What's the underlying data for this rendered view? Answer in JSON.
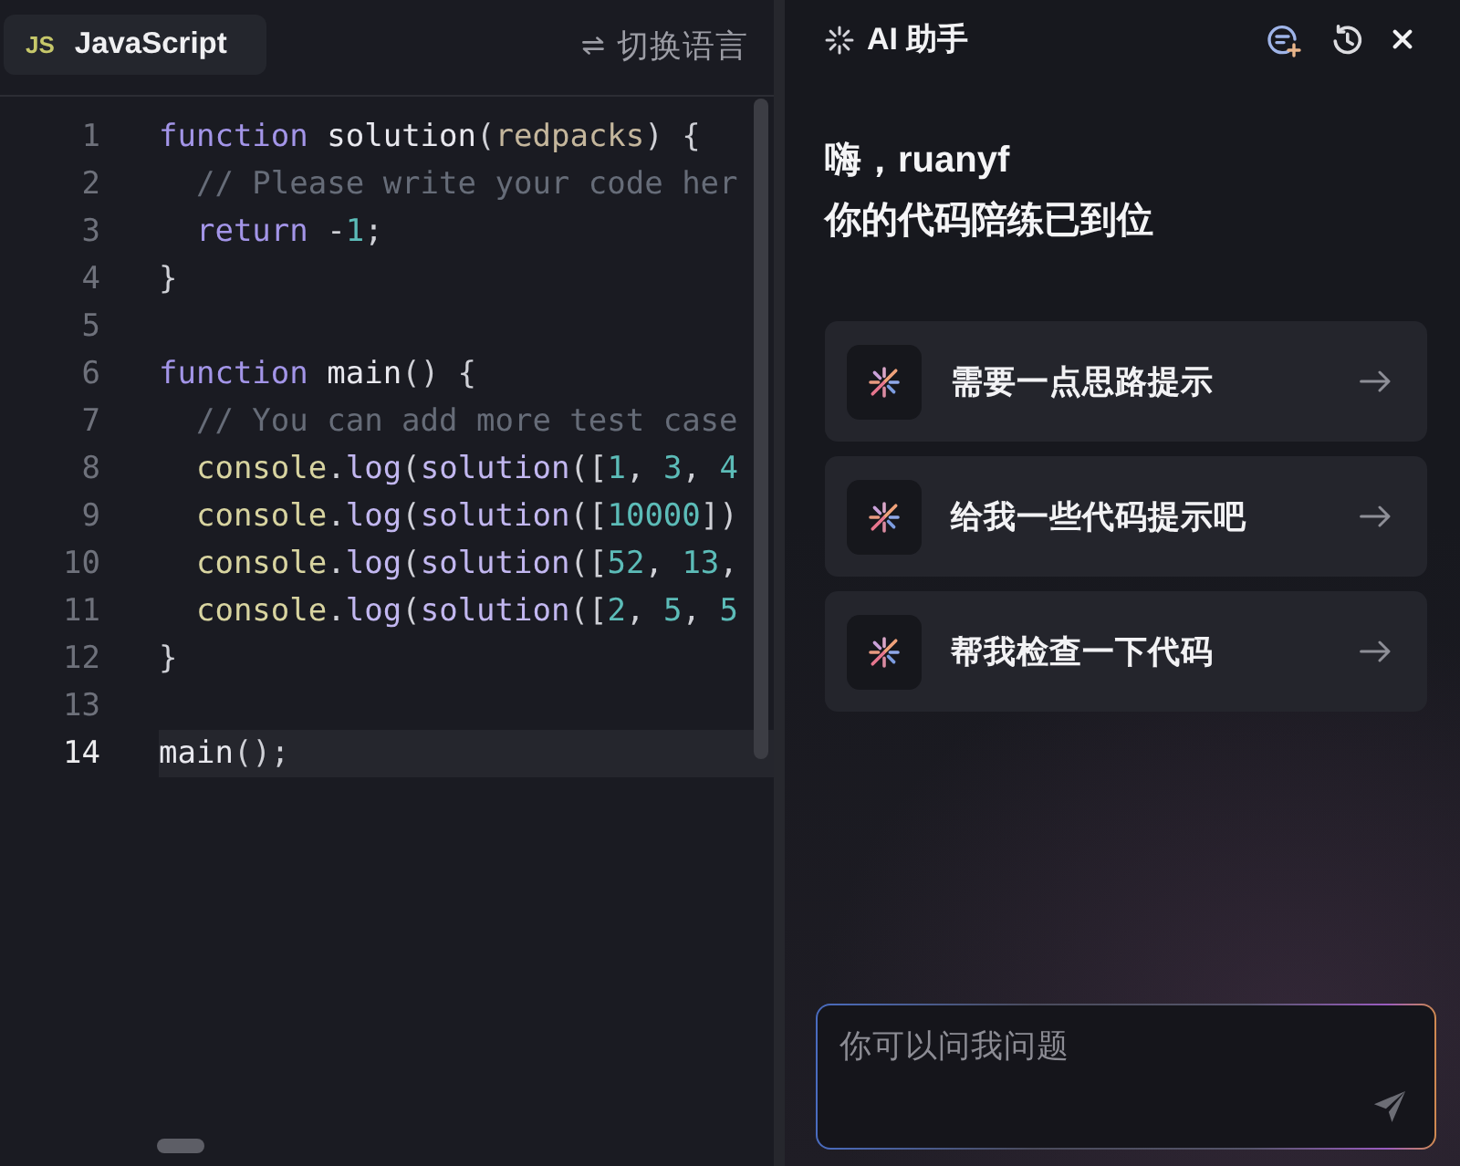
{
  "editor": {
    "language_tab": {
      "badge": "JS",
      "label": "JavaScript"
    },
    "switch_language": {
      "label": "切换语言"
    },
    "lines": [
      {
        "number": "1",
        "current": false,
        "tokens": [
          {
            "kind": "keyword",
            "text": "function "
          },
          {
            "kind": "function",
            "text": "solution"
          },
          {
            "kind": "punct",
            "text": "("
          },
          {
            "kind": "param",
            "text": "redpacks"
          },
          {
            "kind": "punct",
            "text": ") {"
          }
        ]
      },
      {
        "number": "2",
        "current": false,
        "tokens": [
          {
            "kind": "comment",
            "text": "  // Please write your code her"
          }
        ]
      },
      {
        "number": "3",
        "current": false,
        "tokens": [
          {
            "kind": "keyword",
            "text": "  return"
          },
          {
            "kind": "punct",
            "text": " -"
          },
          {
            "kind": "number",
            "text": "1"
          },
          {
            "kind": "punct",
            "text": ";"
          }
        ]
      },
      {
        "number": "4",
        "current": false,
        "tokens": [
          {
            "kind": "punct",
            "text": "}"
          }
        ]
      },
      {
        "number": "5",
        "current": false
      },
      {
        "number": "6",
        "current": false,
        "tokens": [
          {
            "kind": "keyword",
            "text": "function "
          },
          {
            "kind": "function",
            "text": "main"
          },
          {
            "kind": "punct",
            "text": "() {"
          }
        ]
      },
      {
        "number": "7",
        "current": false,
        "tokens": [
          {
            "kind": "comment",
            "text": "  // You can add more test case"
          }
        ]
      },
      {
        "number": "8",
        "current": false,
        "tokens": [
          {
            "kind": "object",
            "text": "  console"
          },
          {
            "kind": "punct",
            "text": "."
          },
          {
            "kind": "call",
            "text": "log"
          },
          {
            "kind": "punct",
            "text": "("
          },
          {
            "kind": "call",
            "text": "solution"
          },
          {
            "kind": "punct",
            "text": "(["
          },
          {
            "kind": "number",
            "text": "1"
          },
          {
            "kind": "punct",
            "text": ", "
          },
          {
            "kind": "number",
            "text": "3"
          },
          {
            "kind": "punct",
            "text": ", "
          },
          {
            "kind": "number",
            "text": "4"
          }
        ]
      },
      {
        "number": "9",
        "current": false,
        "tokens": [
          {
            "kind": "object",
            "text": "  console"
          },
          {
            "kind": "punct",
            "text": "."
          },
          {
            "kind": "call",
            "text": "log"
          },
          {
            "kind": "punct",
            "text": "("
          },
          {
            "kind": "call",
            "text": "solution"
          },
          {
            "kind": "punct",
            "text": "(["
          },
          {
            "kind": "number",
            "text": "10000"
          },
          {
            "kind": "punct",
            "text": "])"
          }
        ]
      },
      {
        "number": "10",
        "current": false,
        "tokens": [
          {
            "kind": "object",
            "text": "  console"
          },
          {
            "kind": "punct",
            "text": "."
          },
          {
            "kind": "call",
            "text": "log"
          },
          {
            "kind": "punct",
            "text": "("
          },
          {
            "kind": "call",
            "text": "solution"
          },
          {
            "kind": "punct",
            "text": "(["
          },
          {
            "kind": "number",
            "text": "52"
          },
          {
            "kind": "punct",
            "text": ", "
          },
          {
            "kind": "number",
            "text": "13"
          },
          {
            "kind": "punct",
            "text": ","
          }
        ]
      },
      {
        "number": "11",
        "current": false,
        "tokens": [
          {
            "kind": "object",
            "text": "  console"
          },
          {
            "kind": "punct",
            "text": "."
          },
          {
            "kind": "call",
            "text": "log"
          },
          {
            "kind": "punct",
            "text": "("
          },
          {
            "kind": "call",
            "text": "solution"
          },
          {
            "kind": "punct",
            "text": "(["
          },
          {
            "kind": "number",
            "text": "2"
          },
          {
            "kind": "punct",
            "text": ", "
          },
          {
            "kind": "number",
            "text": "5"
          },
          {
            "kind": "punct",
            "text": ", "
          },
          {
            "kind": "number",
            "text": "5"
          }
        ]
      },
      {
        "number": "12",
        "current": false,
        "tokens": [
          {
            "kind": "punct",
            "text": "}"
          }
        ]
      },
      {
        "number": "13",
        "current": false
      },
      {
        "number": "14",
        "current": true,
        "tokens": [
          {
            "kind": "function",
            "text": "main"
          },
          {
            "kind": "punct",
            "text": "();"
          }
        ]
      }
    ]
  },
  "assistant": {
    "title": "AI 助手",
    "greeting": "嗨，ruanyf",
    "subtitle": "你的代码陪练已到位",
    "suggestions": [
      {
        "label": "需要一点思路提示"
      },
      {
        "label": "给我一些代码提示吧"
      },
      {
        "label": "帮我检查一下代码"
      }
    ],
    "input": {
      "placeholder": "你可以问我问题"
    }
  }
}
